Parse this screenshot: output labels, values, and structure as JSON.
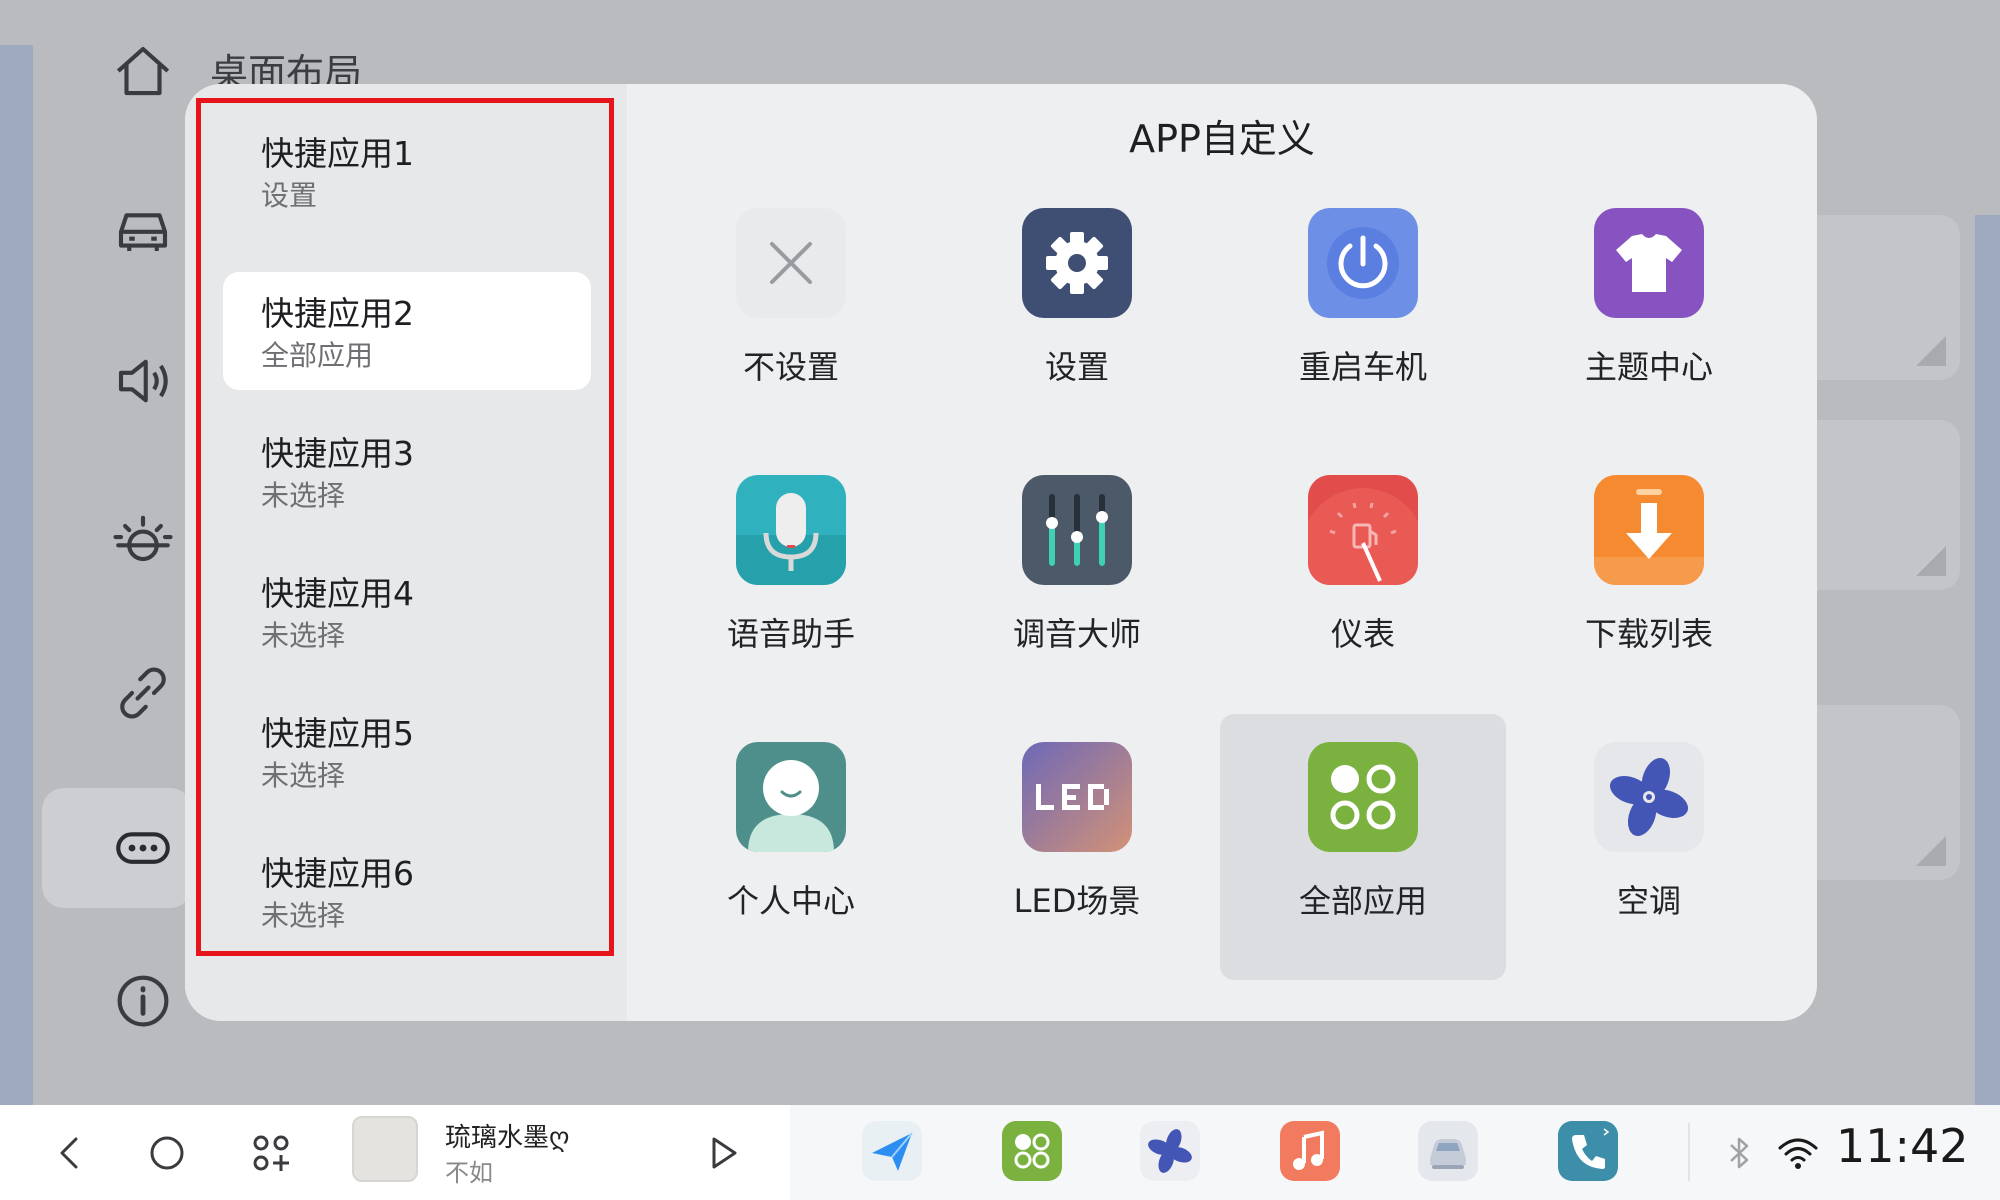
{
  "background_page": {
    "title": "桌面布局",
    "nav_icons": [
      "home-icon",
      "car-icon",
      "speaker-icon",
      "brightness-icon",
      "link-icon",
      "more-icon",
      "info-icon"
    ]
  },
  "modal": {
    "title": "APP自定义",
    "slots": [
      {
        "title": "快捷应用1",
        "value": "设置"
      },
      {
        "title": "快捷应用2",
        "value": "全部应用",
        "selected": true
      },
      {
        "title": "快捷应用3",
        "value": "未选择"
      },
      {
        "title": "快捷应用4",
        "value": "未选择"
      },
      {
        "title": "快捷应用5",
        "value": "未选择"
      },
      {
        "title": "快捷应用6",
        "value": "未选择"
      }
    ],
    "apps": [
      {
        "label": "不设置",
        "icon": "close-icon"
      },
      {
        "label": "设置",
        "icon": "gear-icon"
      },
      {
        "label": "重启车机",
        "icon": "power-icon"
      },
      {
        "label": "主题中心",
        "icon": "tshirt-icon"
      },
      {
        "label": "语音助手",
        "icon": "microphone-icon"
      },
      {
        "label": "调音大师",
        "icon": "equalizer-icon"
      },
      {
        "label": "仪表",
        "icon": "gauge-icon"
      },
      {
        "label": "下载列表",
        "icon": "download-icon"
      },
      {
        "label": "个人中心",
        "icon": "user-icon"
      },
      {
        "label": "LED场景",
        "icon": "led-icon"
      },
      {
        "label": "全部应用",
        "icon": "all-apps-icon",
        "selected": true
      },
      {
        "label": "空调",
        "icon": "fan-icon"
      }
    ]
  },
  "dock": {
    "music_title": "琉璃水墨ღ",
    "music_artist": "不如",
    "time": "11:42"
  },
  "colors": {
    "selection_border": "#e8141c",
    "settings_icon": "#3f4e73",
    "power_icon": "#6d8fe6",
    "theme_icon": "#8753c0",
    "voice_icon": "#2fb2bd",
    "gauge_icon": "#e24c4a",
    "download_icon": "#f58a30",
    "user_icon": "#4f8f8b",
    "all_apps_icon": "#7ab13f",
    "fan_icon": "#4356b5"
  }
}
